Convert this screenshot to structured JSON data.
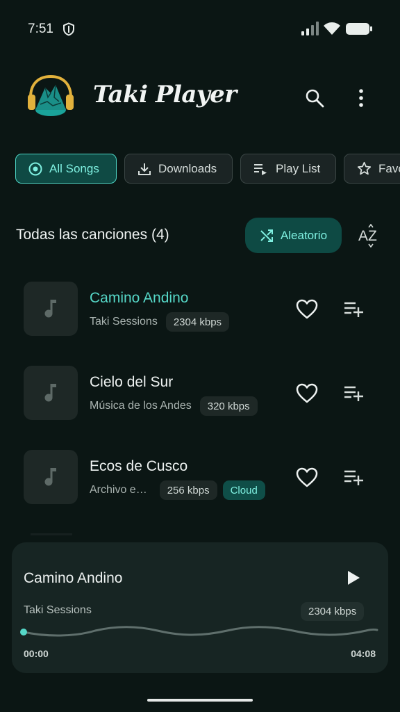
{
  "status_bar": {
    "time": "7:51"
  },
  "header": {
    "app_title": "Taki Player"
  },
  "chips": [
    {
      "label": "All Songs",
      "icon": "disc-icon",
      "active": true
    },
    {
      "label": "Downloads",
      "icon": "download-icon",
      "active": false
    },
    {
      "label": "Play List",
      "icon": "playlist-play-icon",
      "active": false
    },
    {
      "label": "Favo",
      "icon": "star-icon",
      "active": false
    }
  ],
  "section": {
    "title": "Todas las canciones (4)",
    "shuffle_label": "Aleatorio",
    "sort_label": "AZ"
  },
  "songs": [
    {
      "title": "Camino Andino",
      "artist": "Taki Sessions",
      "bitrate": "2304 kbps",
      "playing": true
    },
    {
      "title": "Cielo del Sur",
      "artist": "Música de los Andes",
      "bitrate": "320 kbps"
    },
    {
      "title": "Ecos de Cusco",
      "artist": "Archivo e…",
      "bitrate": "256 kbps",
      "source": "Cloud"
    }
  ],
  "player": {
    "title": "Camino Andino",
    "artist": "Taki Sessions",
    "bitrate": "2304 kbps",
    "elapsed": "00:00",
    "duration": "04:08",
    "progress": 0
  },
  "colors": {
    "background": "#0b1614",
    "accent": "#56d8c8",
    "accent_dark": "#0f4a44",
    "surface": "#172523"
  }
}
